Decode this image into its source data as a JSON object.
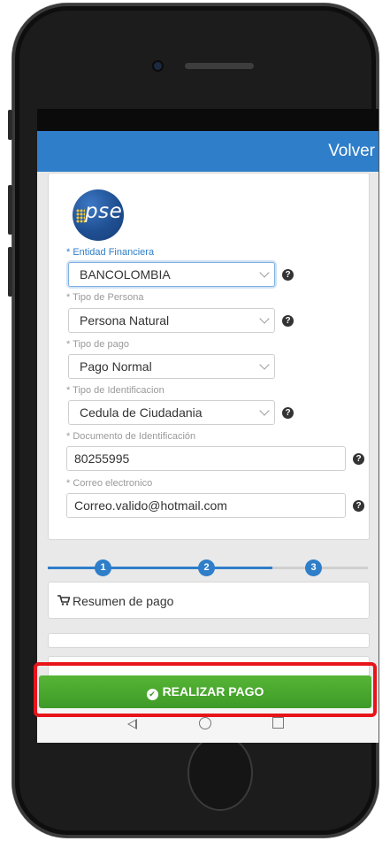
{
  "header": {
    "back_label": "Volver"
  },
  "logo": {
    "text": "pse"
  },
  "form": {
    "entidad": {
      "label": "* Entidad Financiera",
      "value": "BANCOLOMBIA"
    },
    "tipo_persona": {
      "label": "* Tipo de Persona",
      "value": "Persona Natural"
    },
    "tipo_pago": {
      "label": "* Tipo de pago",
      "value": "Pago Normal"
    },
    "tipo_identificacion": {
      "label": "* Tipo de Identificacion",
      "value": "Cedula de Ciudadania"
    },
    "documento": {
      "label": "* Documento de Identificación",
      "value": "80255995"
    },
    "correo": {
      "label": "* Correo electronico",
      "value": "Correo.valido@hotmail.com"
    }
  },
  "stepper": {
    "steps": [
      "1",
      "2",
      "3"
    ],
    "current_step": 2
  },
  "summary": {
    "label": "Resumen de pago"
  },
  "pay_button": {
    "label": "REALIZAR PAGO"
  },
  "colors": {
    "primary": "#2f7ec9",
    "success": "#4aa82e",
    "highlight": "#e8141a"
  },
  "icons": {
    "help": "question-circle-icon",
    "cart": "cart-icon",
    "check": "check-circle-icon",
    "nav_back": "triangle-back-icon",
    "nav_home": "circle-home-icon",
    "nav_recent": "square-recent-icon"
  }
}
